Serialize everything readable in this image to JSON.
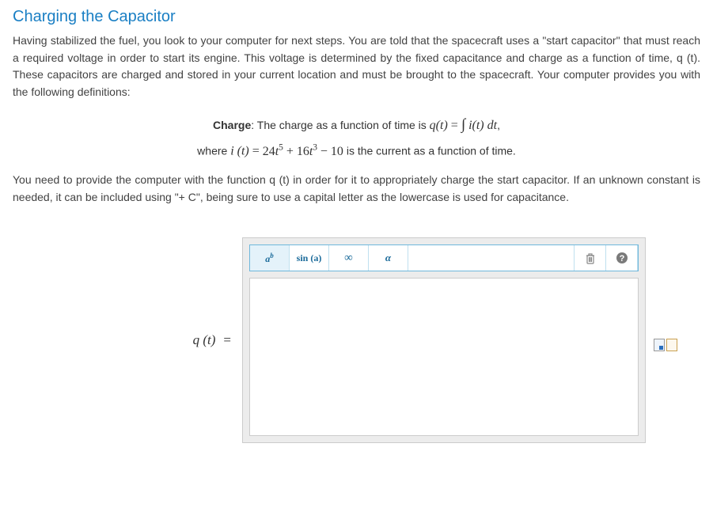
{
  "title": "Charging the Capacitor",
  "para1": "Having stabilized the fuel, you look to your computer for next steps. You are told that the spacecraft uses a \"start capacitor\" that must reach a required voltage in order to start its engine. This voltage is determined by the fixed capacitance and charge as a function of time, q (t). These capacitors are charged and stored in your current location and must be brought to the spacecraft. Your computer provides you with the following definitions:",
  "definition": {
    "label": "Charge",
    "text_before": ": The charge as a function of time is ",
    "equation_lhs": "q(t) = ",
    "equation_rhs": "∫ i(t) dt",
    "trailing": ",",
    "line2_pre": "where ",
    "line2_eq": "i (t) = 24t⁵ + 16t³ − 10",
    "line2_post": " is the current as a function of time."
  },
  "para2": "You need to provide the computer with the function q (t) in order for it to appropriately charge the start capacitor. If an unknown constant is needed, it can be included using \"+ C\", being sure to use a capital letter as the lowercase is used for capacitance.",
  "editor": {
    "lhs": "q (t)",
    "eq": "=",
    "toolbar": {
      "exponent": "a^b",
      "trig": "sin (a)",
      "infinity": "∞",
      "greek": "α",
      "trash": "trash",
      "help": "?"
    },
    "value": ""
  }
}
